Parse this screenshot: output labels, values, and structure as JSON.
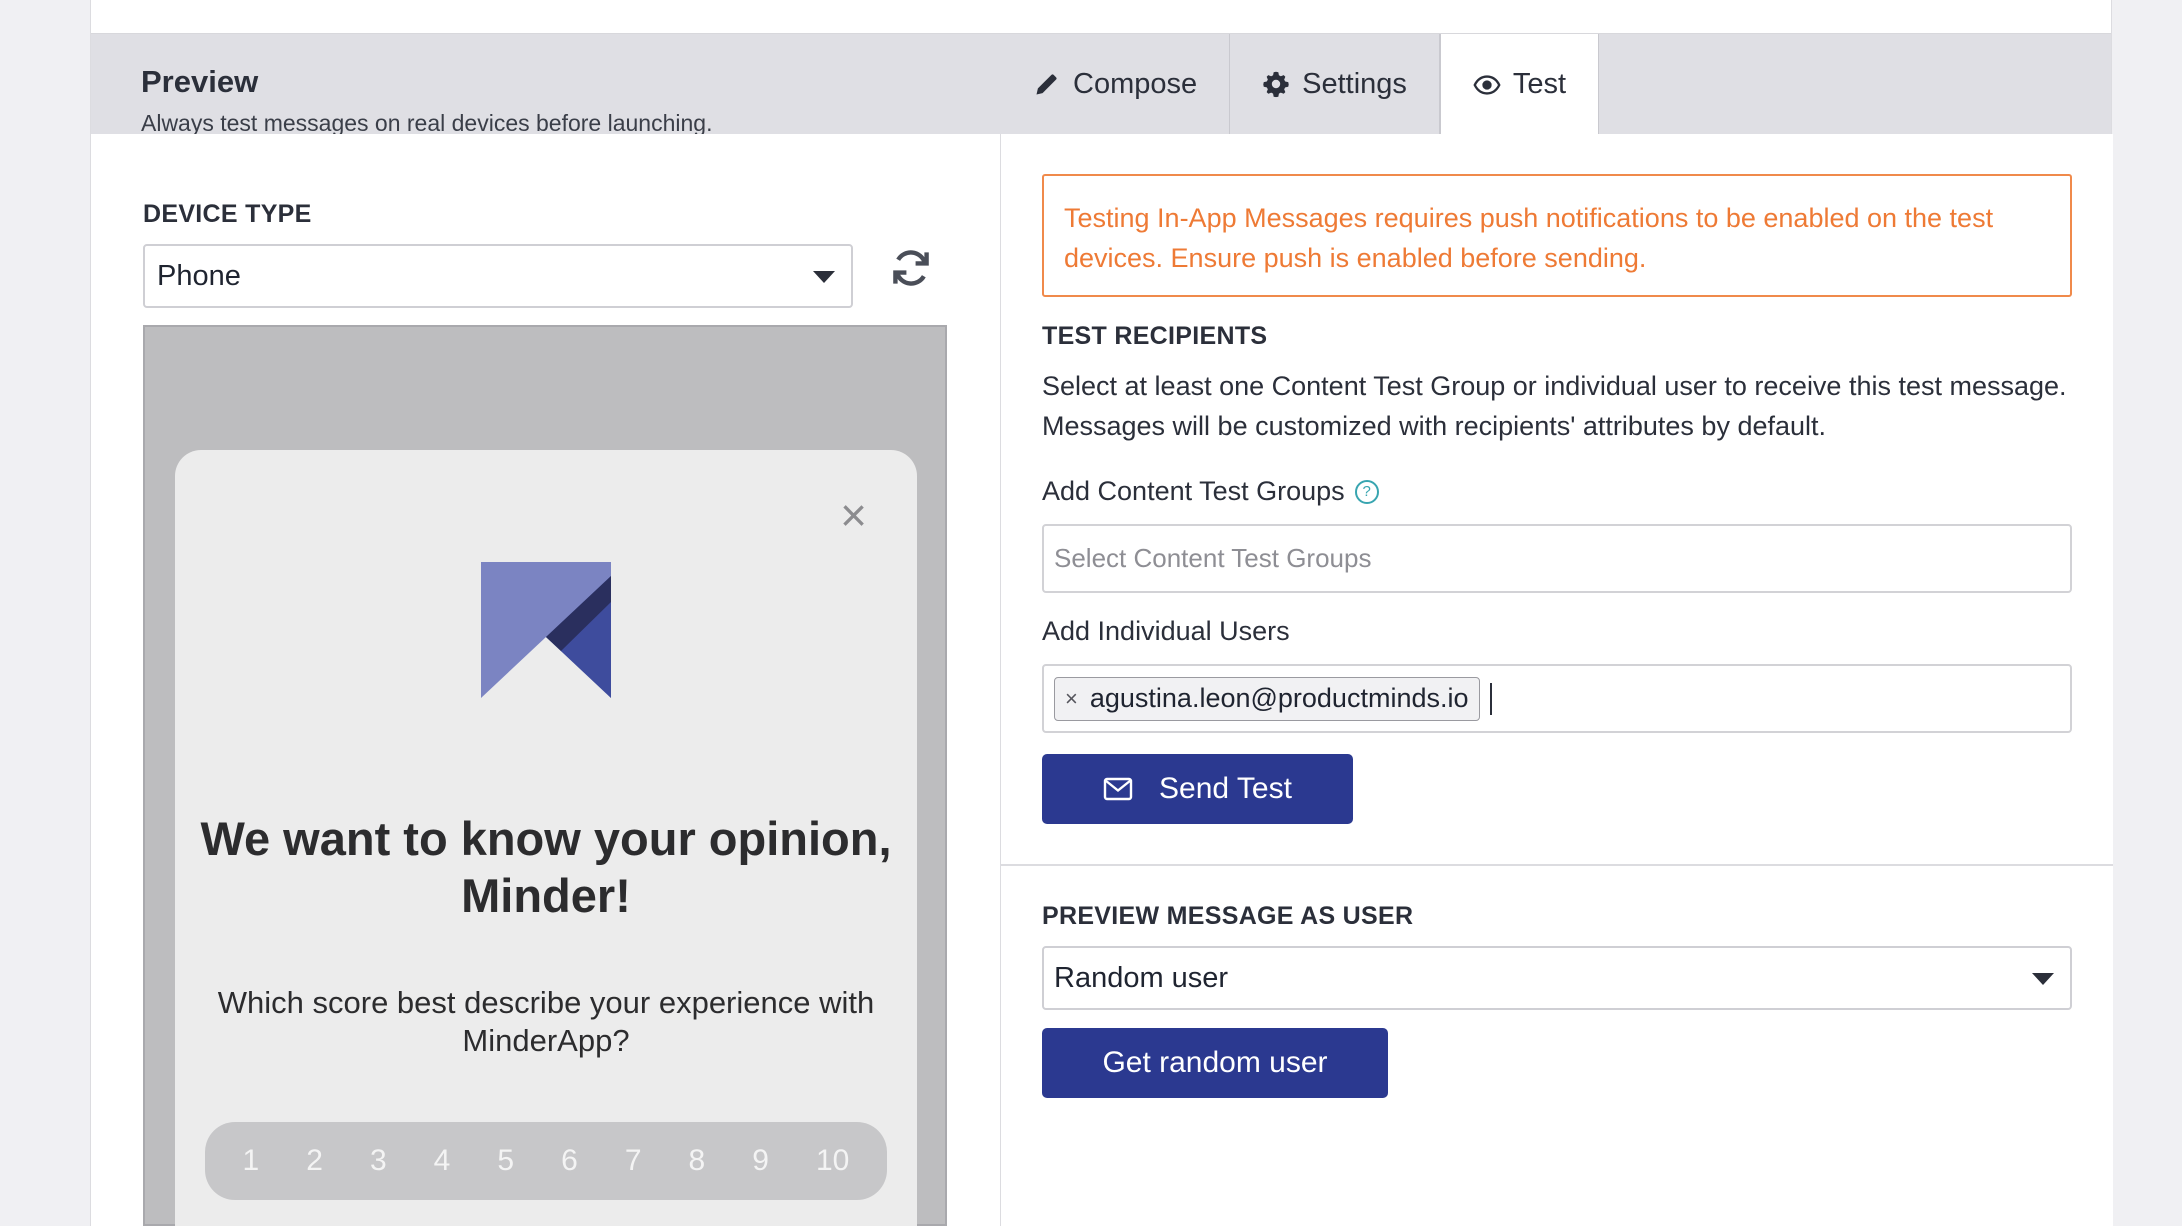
{
  "header": {
    "title": "Preview",
    "subtitle": "Always test messages on real devices before launching.",
    "tabs": [
      {
        "label": "Compose",
        "icon": "pencil-icon"
      },
      {
        "label": "Settings",
        "icon": "gear-icon"
      },
      {
        "label": "Test",
        "icon": "eye-icon",
        "active": true
      }
    ]
  },
  "preview": {
    "device_type_label": "DEVICE TYPE",
    "device_type_value": "Phone",
    "message": {
      "close_glyph": "×",
      "headline": "We want to know your opinion, Minder!",
      "question": "Which score best describe your experience with MinderApp?",
      "scale": [
        "1",
        "2",
        "3",
        "4",
        "5",
        "6",
        "7",
        "8",
        "9",
        "10"
      ]
    }
  },
  "test": {
    "alert": "Testing In-App Messages requires push notifications to be enabled on the test devices. Ensure push is enabled before sending.",
    "recipients_label": "TEST RECIPIENTS",
    "recipients_desc": "Select at least one Content Test Group or individual user to receive this test message. Messages will be customized with recipients' attributes by default.",
    "groups_label": "Add Content Test Groups",
    "groups_help": "?",
    "groups_placeholder": "Select Content Test Groups",
    "users_label": "Add Individual Users",
    "users_chip": "agustina.leon@productminds.io",
    "chip_remove": "×",
    "send_label": "Send Test",
    "preview_as_label": "PREVIEW MESSAGE AS USER",
    "preview_as_value": "Random user",
    "random_button": "Get random user"
  },
  "colors": {
    "primary_button": "#2b3990",
    "alert_orange": "#ee7a35",
    "help_teal": "#38a5b0",
    "logo_light": "#7b84c2",
    "logo_dark": "#3e4c9d"
  }
}
